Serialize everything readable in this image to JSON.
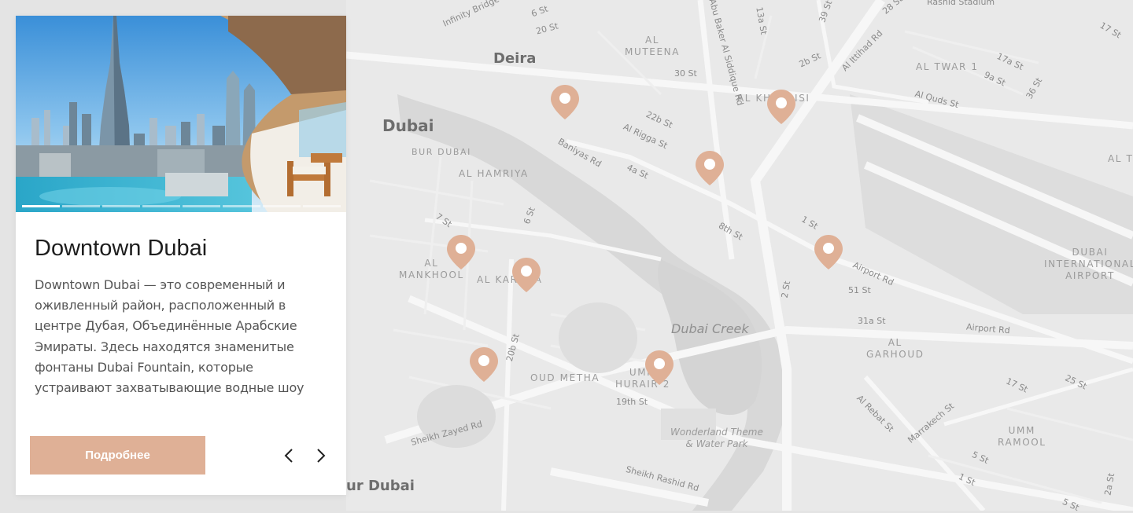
{
  "map": {
    "city_labels": [
      "Deira",
      "Dubai",
      "ur Dubai"
    ],
    "districts": [
      "AL\nMUTEENA",
      "AL KHABAISI",
      "BUR DUBAI",
      "AL HAMRIYA",
      "AL\nMANKHOOL",
      "AL KARAMA",
      "OUD METHA",
      "UMM\nHURAIR 2",
      "AL TWAR 1",
      "DUBAI\nINTERNATIONAL\nAIRPORT",
      "AL\nGARHOUD",
      "UMM\nRAMOOL",
      "AL T"
    ],
    "streets": [
      "Infinity Bridge",
      "6 St",
      "20 St",
      "Abu Baker Al Siddique Rd",
      "13a St",
      "39 St",
      "28 St",
      "Rashid Stadium",
      "17 St",
      "30 St",
      "2b St",
      "Al Ittihad Rd",
      "17a St",
      "9a St",
      "36 St",
      "Al Quds St",
      "22b St",
      "Al Rigga St",
      "Baniyas Rd",
      "4a St",
      "8th St",
      "1 St",
      "7 St",
      "6 St",
      "Airport Rd",
      "51 St",
      "31a St",
      "Airport Rd",
      "2 St",
      "20b St",
      "19th St",
      "17 St",
      "25 St",
      "Al Rebat St",
      "Marrakech St",
      "Sheikh Zayed Rd",
      "Sheikh Rashid Rd",
      "5 St",
      "1 St",
      "5 St",
      "2a St"
    ],
    "water_label": "Dubai Creek",
    "poi_label": "Wonderland Theme\n& Water Park",
    "pin_color": "#dfb096"
  },
  "card": {
    "title": "Downtown Dubai",
    "description": "Downtown Dubai — это современный и оживленный район, расположенный в центре Дубая, Объединённые Арабские Эмираты. Здесь находятся знаменитые фонтаны Dubai Fountain, которые устраивают захватывающие водные шоу",
    "button_label": "Подробнее",
    "prev_icon": "chevron-left-icon",
    "next_icon": "chevron-right-icon",
    "slides_total": 8,
    "active_slide": 1,
    "accent_color": "#dfb096"
  }
}
